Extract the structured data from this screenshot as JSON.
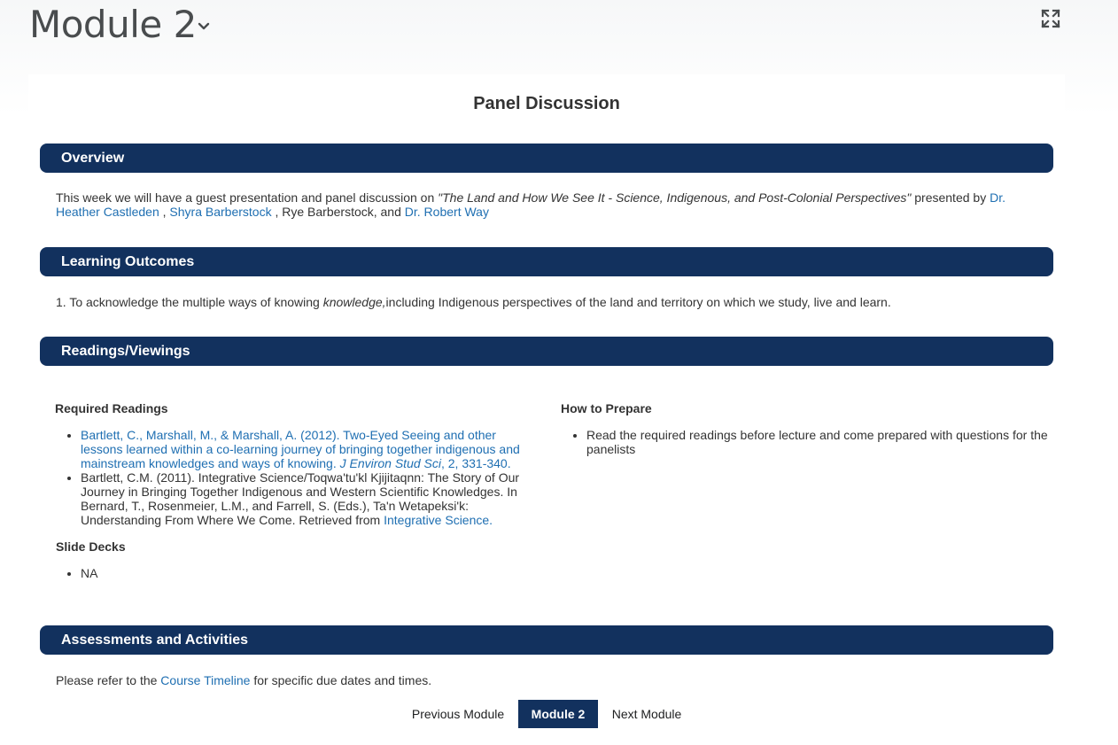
{
  "header": {
    "module_title": "Module 2",
    "chevron_icon": "chevron-down-icon",
    "expand_icon": "fullscreen-expand-icon"
  },
  "page_title": "Panel Discussion",
  "overview": {
    "heading": "Overview",
    "text_before": "This week we will have a guest presentation and panel discussion on ",
    "talk_title": "\"The Land and How We See It - Science, Indigenous, and Post-Colonial Perspectives\"",
    "text_presented_by": " presented by ",
    "presenter_1": "Dr. Heather Castleden",
    "sep_1": " , ",
    "presenter_2": "Shyra Barberstock",
    "sep_2": " , Rye Barberstock, and ",
    "presenter_3": "Dr. Robert Way"
  },
  "learning_outcomes": {
    "heading": "Learning Outcomes",
    "item_number": "1.",
    "text_before": "To acknowledge the multiple ways of knowing ",
    "emphasis": "knowledge,",
    "text_after": "including Indigenous perspectives of the land and territory on which we study, live and learn."
  },
  "readings": {
    "heading": "Readings/Viewings",
    "required_heading": "Required Readings",
    "reading_1_link": "Bartlett, C., Marshall, M., & Marshall, A. (2012). Two-Eyed Seeing and other lessons learned within a co-learning journey of bringing together indigenous and mainstream knowledges and ways of knowing. ",
    "reading_1_journal": "J Environ Stud Sci",
    "reading_1_tail": ", 2, 331-340.",
    "reading_2_text": "Bartlett, C.M. (2011). Integrative Science/Toqwa'tu'kl Kjijitaqnn: The Story of Our Journey in Bringing Together Indigenous and Western Scientific Knowledges. In Bernard, T., Rosenmeier, L.M., and Farrell, S. (Eds.), Ta'n Wetapeksi'k: Understanding From Where We Come. Retrieved from ",
    "reading_2_link": "Integrative Science.",
    "slides_heading": "Slide Decks",
    "slides_item": "NA",
    "prepare_heading": "How to Prepare",
    "prepare_item": "Read the required readings before lecture and come prepared with questions for the panelists"
  },
  "assessments": {
    "heading": "Assessments and Activities",
    "text_before": "Please refer to the ",
    "link": "Course Timeline",
    "text_after": " for specific due dates and times."
  },
  "nav": {
    "previous": "Previous Module",
    "current": "Module 2",
    "next": "Next Module"
  },
  "colors": {
    "section_bar": "#12315e",
    "link": "#1f6fb2"
  }
}
